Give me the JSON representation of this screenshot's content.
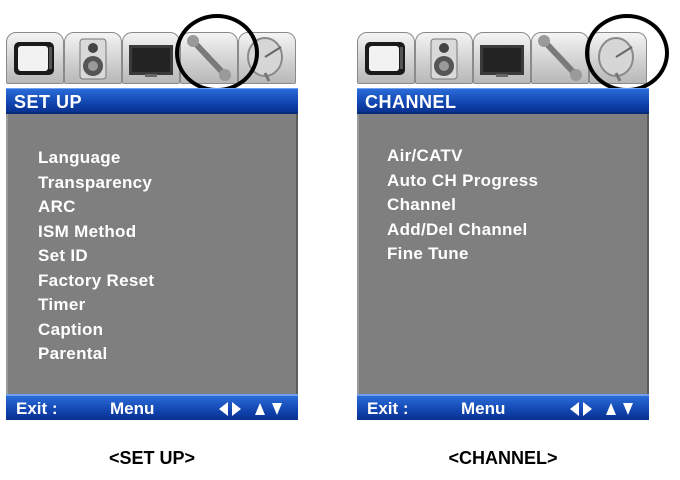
{
  "screens": [
    {
      "title": "SET UP",
      "tab_icons": [
        "tv-icon",
        "speaker-icon",
        "screen-icon",
        "wrench-icon",
        "satellite-dish-icon"
      ],
      "selected_tab_icon": "wrench-icon",
      "items": [
        "Language",
        "Transparency",
        "ARC",
        "ISM Method",
        "Set ID",
        "Factory Reset",
        "Timer",
        "Caption",
        "Parental"
      ],
      "footer": {
        "exit_label": "Exit :",
        "menu_label": "Menu"
      },
      "caption": "<SET UP>"
    },
    {
      "title": "CHANNEL",
      "tab_icons": [
        "tv-icon",
        "speaker-icon",
        "screen-icon",
        "wrench-icon",
        "satellite-dish-icon"
      ],
      "selected_tab_icon": "satellite-dish-icon",
      "items": [
        "Air/CATV",
        "Auto CH Progress",
        "Channel",
        "Add/Del Channel",
        "Fine Tune"
      ],
      "footer": {
        "exit_label": "Exit :",
        "menu_label": "Menu"
      },
      "caption": "<CHANNEL>"
    }
  ],
  "colors": {
    "bar_blue": "#0e3fa8",
    "panel_gray": "#7f7f7f",
    "text_white": "#ffffff",
    "highlight_circle": "#000000"
  }
}
